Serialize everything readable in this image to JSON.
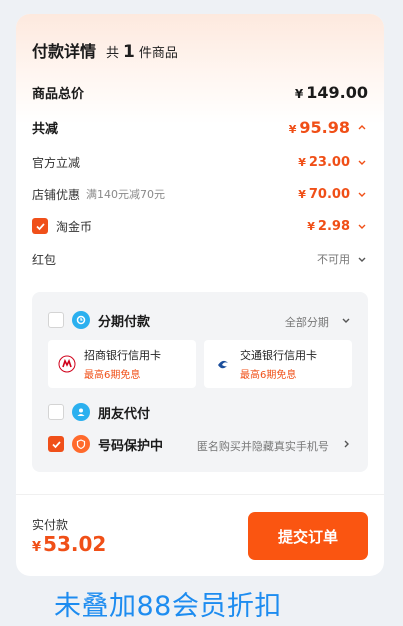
{
  "header": {
    "title": "付款详情",
    "count_prefix": "共",
    "count": "1",
    "count_suffix": "件商品"
  },
  "rows": {
    "subtotal": {
      "label": "商品总价",
      "currency": "¥",
      "amount": "149.00"
    },
    "discount_total": {
      "label": "共减",
      "currency": "¥",
      "amount": "95.98"
    },
    "official": {
      "label": "官方立减",
      "currency": "¥",
      "amount": "23.00"
    },
    "store": {
      "label": "店铺优惠",
      "note": "满140元减70元",
      "currency": "¥",
      "amount": "70.00"
    },
    "coins": {
      "label": "淘金币",
      "currency": "¥",
      "amount": "2.98",
      "checked": true
    },
    "redpacket": {
      "label": "红包",
      "value": "不可用"
    }
  },
  "payment": {
    "installment": {
      "label": "分期付款",
      "option": "全部分期",
      "checked": false
    },
    "banks": [
      {
        "name": "招商银行信用卡",
        "promo": "最高6期免息"
      },
      {
        "name": "交通银行信用卡",
        "promo": "最高6期免息"
      }
    ],
    "friend_pay": {
      "label": "朋友代付",
      "checked": false
    },
    "number_protect": {
      "label": "号码保护中",
      "desc": "匿名购买并隐藏真实手机号",
      "checked": true
    }
  },
  "footer": {
    "paid_label": "实付款",
    "currency": "¥",
    "paid_amount": "53.02",
    "submit_label": "提交订单"
  },
  "caption": "未叠加88会员折扣",
  "colors": {
    "accent": "#f04f17",
    "button": "#fa5511",
    "caption": "#1d8cf0"
  }
}
